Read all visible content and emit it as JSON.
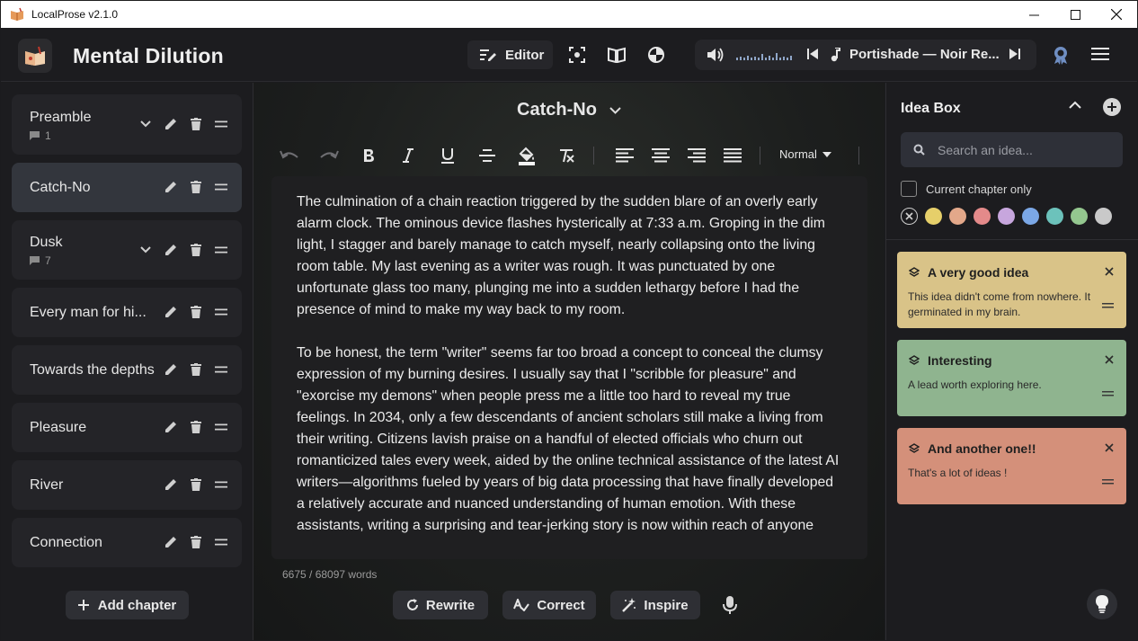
{
  "window": {
    "title": "LocalProse v2.1.0"
  },
  "header": {
    "book_title": "Mental Dilution",
    "editor_label": "Editor",
    "player": {
      "track": "Portishade — Noir Re..."
    }
  },
  "sidebar": {
    "chapters": [
      {
        "name": "Preamble",
        "notes": "1"
      },
      {
        "name": "Catch-No"
      },
      {
        "name": "Dusk",
        "notes": "7"
      },
      {
        "name": "Every man for hi..."
      },
      {
        "name": "Towards the depths"
      },
      {
        "name": "Pleasure"
      },
      {
        "name": "River"
      },
      {
        "name": "Connection"
      }
    ],
    "add_chapter": "Add chapter"
  },
  "editor": {
    "chapter_title": "Catch-No",
    "style_select": "Normal",
    "paragraphs": [
      "The culmination of a chain reaction triggered by the sudden blare of an overly early alarm clock. The ominous device flashes hysterically at 7:33 a.m. Groping in the dim light, I stagger and barely manage to catch myself, nearly collapsing onto the living room table. My last evening as a writer was rough. It was punctuated by one unfortunate glass too many, plunging me into a sudden lethargy before I had the presence of mind to make my way back to my room.",
      "To be honest, the term \"writer\" seems far too broad a concept to conceal the clumsy expression of my burning desires. I usually say that I \"scribble for pleasure\" and \"exorcise my demons\" when people press me a little too hard to reveal my true feelings. In 2034, only a few descendants of ancient scholars still make a living from their writing. Citizens lavish praise on a handful of elected officials who churn out romanticized tales every week, aided by the online technical assistance of the latest AI writers—algorithms fueled by years of big data processing that have finally developed a relatively accurate and nuanced understanding of human emotion. With these assistants, writing a surprising and tear-jerking story is now within reach of anyone"
    ],
    "word_count": "6675 / 68097 words",
    "actions": {
      "rewrite": "Rewrite",
      "correct": "Correct",
      "inspire": "Inspire"
    }
  },
  "idea_box": {
    "title": "Idea Box",
    "search_placeholder": "Search an idea...",
    "current_chapter_only": "Current chapter only",
    "swatch_colors": [
      "#e6cf6a",
      "#e3a88a",
      "#e48a8a",
      "#c7a6dd",
      "#7ba7e6",
      "#6cc2bb",
      "#94c78f",
      "#c9c9c9"
    ],
    "ideas": [
      {
        "title": "A very good idea",
        "body": "This idea didn't come from nowhere. It germinated in my brain.",
        "color": "#d9c388"
      },
      {
        "title": "Interesting",
        "body": "A lead worth exploring here.",
        "color": "#8fb48f"
      },
      {
        "title": "And another one!!",
        "body": "That's a lot of ideas !",
        "color": "#d4907a"
      }
    ]
  }
}
